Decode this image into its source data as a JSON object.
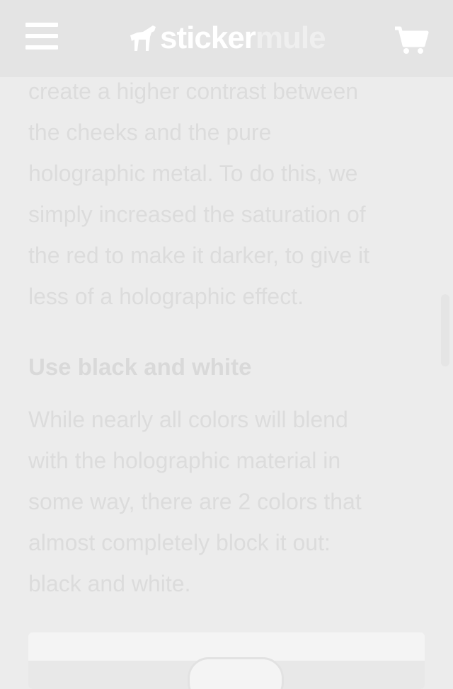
{
  "header": {
    "logo_left": "sticker",
    "logo_right": "mule",
    "menu_icon": "hamburger-menu-icon",
    "cart_icon": "shopping-cart-icon",
    "background": "#e4e4e4"
  },
  "article": {
    "paragraph1_lines": [
      "create a higher contrast between",
      "the cheeks and the pure",
      "holographic metal. To do this, we",
      "simply increased the saturation of",
      "the red to make it darker, to give it",
      "less of a holographic effect."
    ],
    "heading": "Use black and white",
    "paragraph2_lines": [
      "While nearly all colors will blend",
      "with the holographic material in",
      "some way, there are 2 colors that",
      "almost completely block it out:",
      "black and white."
    ]
  }
}
